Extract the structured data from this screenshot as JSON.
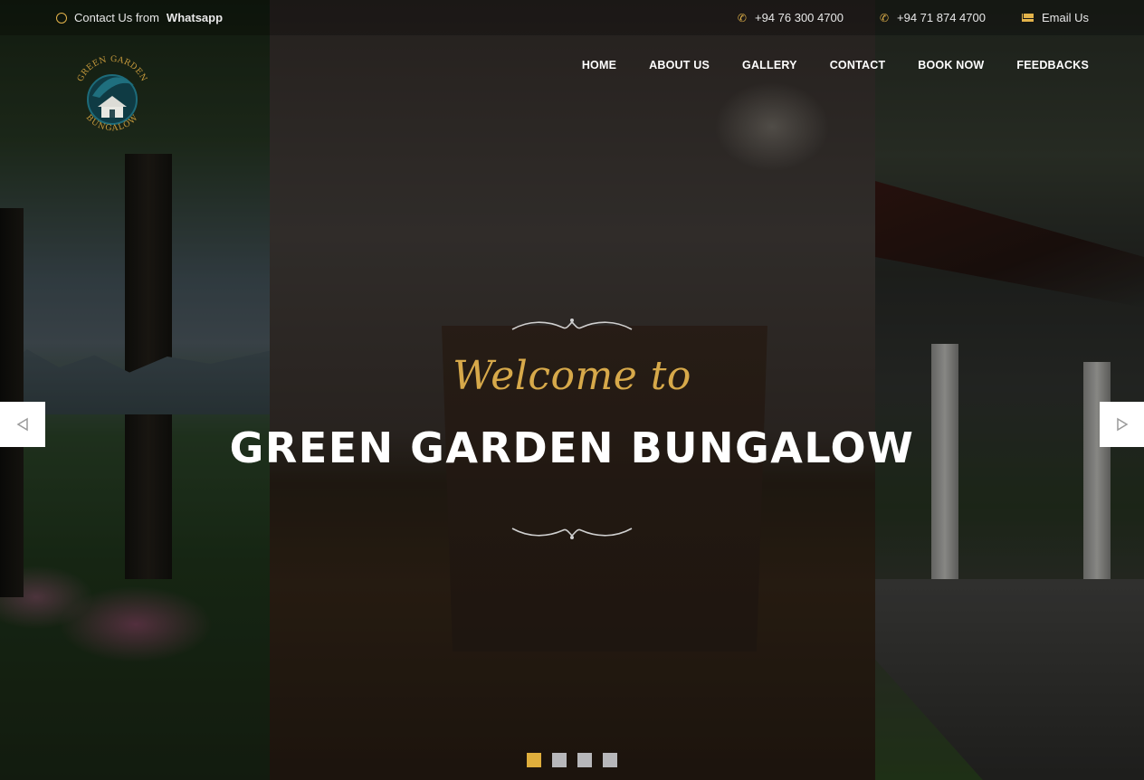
{
  "topbar": {
    "whatsapp_prefix": "Contact Us from",
    "whatsapp_brand": "Whatsapp",
    "whatsapp_icon": "whatsapp-icon",
    "phone1": "+94 76 300 4700",
    "phone2": "+94 71 874 4700",
    "phone_icon": "phone-icon",
    "email": "Email Us",
    "email_icon": "envelope-icon"
  },
  "logo": {
    "top_text": "GREEN GARDEN",
    "bottom_text": "BUNGALOW"
  },
  "nav": {
    "items": [
      "HOME",
      "ABOUT US",
      "GALLERY",
      "CONTACT",
      "BOOK NOW",
      "FEEDBACKS"
    ]
  },
  "hero": {
    "welcome": "Welcome to",
    "title": "GREEN GARDEN BUNGALOW",
    "prev_icon": "triangle-left-icon",
    "next_icon": "triangle-right-icon"
  },
  "slider": {
    "slide_count": 4,
    "active_index": 0
  },
  "colors": {
    "accent_gold": "#dfae3c",
    "script_gold": "#d7a94a",
    "dot_inactive": "#b7b7ba",
    "nav_text": "#ffffff"
  }
}
